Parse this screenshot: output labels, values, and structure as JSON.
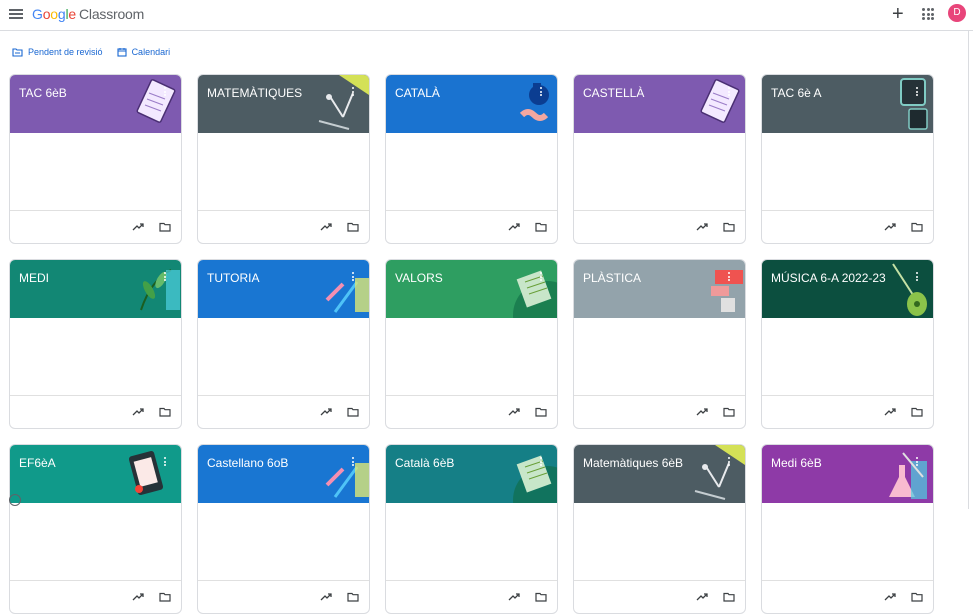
{
  "header": {
    "logo_google": [
      "G",
      "o",
      "o",
      "g",
      "l",
      "e"
    ],
    "product": "Classroom",
    "avatar_initial": "D"
  },
  "links": {
    "pending": "Pendent de revisió",
    "calendar": "Calendari"
  },
  "colors": {
    "purple": "#7e5ab0",
    "slate": "#4d5c63",
    "blue": "#1a73d0",
    "teal": "#128774",
    "tblue": "#1976d2",
    "green": "#2e9e61",
    "gray": "#93a3ab",
    "darkgreen": "#0c4f3f",
    "teal2": "#109a8a",
    "cyan": "#157f86",
    "magenta": "#8e3aa7"
  },
  "courses": [
    {
      "title": "TAC 6èB",
      "color": "purple",
      "icon": "notebook-icon"
    },
    {
      "title": "MATEMÀTIQUES",
      "color": "slate",
      "icon": "compass-icon"
    },
    {
      "title": "CATALÀ",
      "color": "blue",
      "icon": "ink-icon"
    },
    {
      "title": "CASTELLÀ",
      "color": "purple",
      "icon": "notebook-icon"
    },
    {
      "title": "TAC 6è A",
      "color": "slate",
      "icon": "devices-icon"
    },
    {
      "title": "MEDI",
      "color": "teal",
      "icon": "leaves-icon"
    },
    {
      "title": "TUTORIA",
      "color": "tblue",
      "icon": "pencils-icon"
    },
    {
      "title": "VALORS",
      "color": "green",
      "icon": "book-icon"
    },
    {
      "title": "PLÀSTICA",
      "color": "gray",
      "icon": "paint-icon"
    },
    {
      "title": "MÚSICA 6-A 2022-23",
      "color": "darkgreen",
      "icon": "guitar-icon"
    },
    {
      "title": "EF6èA",
      "color": "teal2",
      "icon": "tablet-icon"
    },
    {
      "title": "Castellano 6oB",
      "color": "tblue",
      "icon": "pencils-icon"
    },
    {
      "title": "Català 6èB",
      "color": "cyan",
      "icon": "book-icon"
    },
    {
      "title": "Matemàtiques 6èB",
      "color": "slate",
      "icon": "compass-icon"
    },
    {
      "title": "Medi 6èB",
      "color": "magenta",
      "icon": "flask-icon"
    }
  ]
}
